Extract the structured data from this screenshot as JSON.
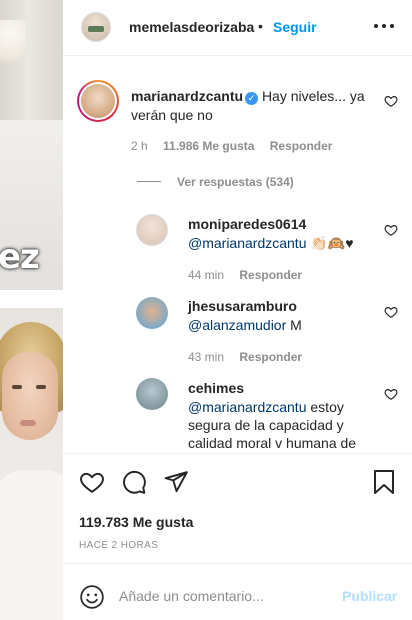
{
  "media": {
    "caption_fragment": "ez"
  },
  "header": {
    "username": "memelasdeorizaba",
    "separator": "•",
    "follow_label": "Seguir",
    "more_icon": "more-horizontal-icon"
  },
  "main_comment": {
    "username": "marianardzcantu",
    "verified": true,
    "text": "Hay niveles... ya verán que no",
    "time": "2 h",
    "likes": "11.986 Me gusta",
    "reply_label": "Responder"
  },
  "view_replies": "Ver respuestas (534)",
  "replies": [
    {
      "username": "moniparedes0614",
      "mention": "@marianardzcantu",
      "text": " 👏🏻🙉♥",
      "time": "44 min",
      "reply_label": "Responder"
    },
    {
      "username": "jhesusaramburo",
      "mention": "@alanzamudior",
      "text": " M",
      "time": "43 min",
      "reply_label": "Responder"
    },
    {
      "username": "cehimes",
      "mention": "@marianardzcantu",
      "text": " estoy segura de la capacidad y calidad moral v humana de"
    }
  ],
  "footer": {
    "likes_count": "119.783 Me gusta",
    "posted_ago": "HACE 2 HORAS"
  },
  "composer": {
    "placeholder": "Añade un comentario...",
    "publish_label": "Publicar",
    "publish_color": "#b2dffc"
  },
  "colors": {
    "accent": "#0095f6",
    "mention": "#00376b",
    "muted": "#8e8e8e",
    "verified": "#3897f0"
  }
}
